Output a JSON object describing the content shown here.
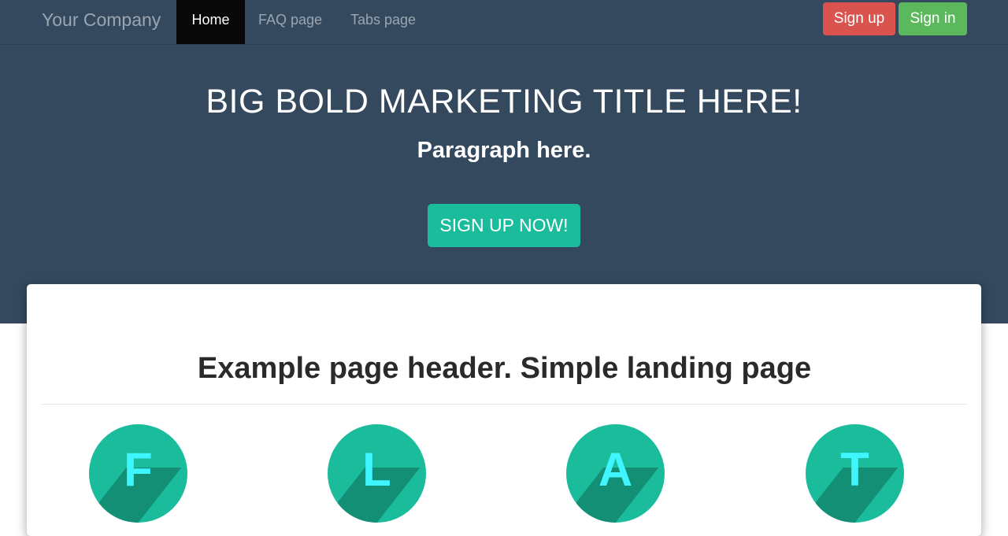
{
  "navbar": {
    "brand": "Your Company",
    "links": [
      {
        "label": "Home",
        "active": true
      },
      {
        "label": "FAQ page",
        "active": false
      },
      {
        "label": "Tabs page",
        "active": false
      }
    ],
    "signup_label": "Sign up",
    "signin_label": "Sign in"
  },
  "hero": {
    "title": "BIG BOLD MARKETING TITLE HERE!",
    "subtitle": "Paragraph here.",
    "cta_label": "SIGN UP NOW!"
  },
  "content": {
    "header": "Example page header. Simple landing page",
    "features": [
      {
        "letter": "F"
      },
      {
        "letter": "L"
      },
      {
        "letter": "A"
      },
      {
        "letter": "T"
      }
    ]
  },
  "colors": {
    "navbar_bg": "#34495e",
    "accent": "#1abc9c",
    "danger": "#d9534f",
    "success": "#5cb85c"
  }
}
